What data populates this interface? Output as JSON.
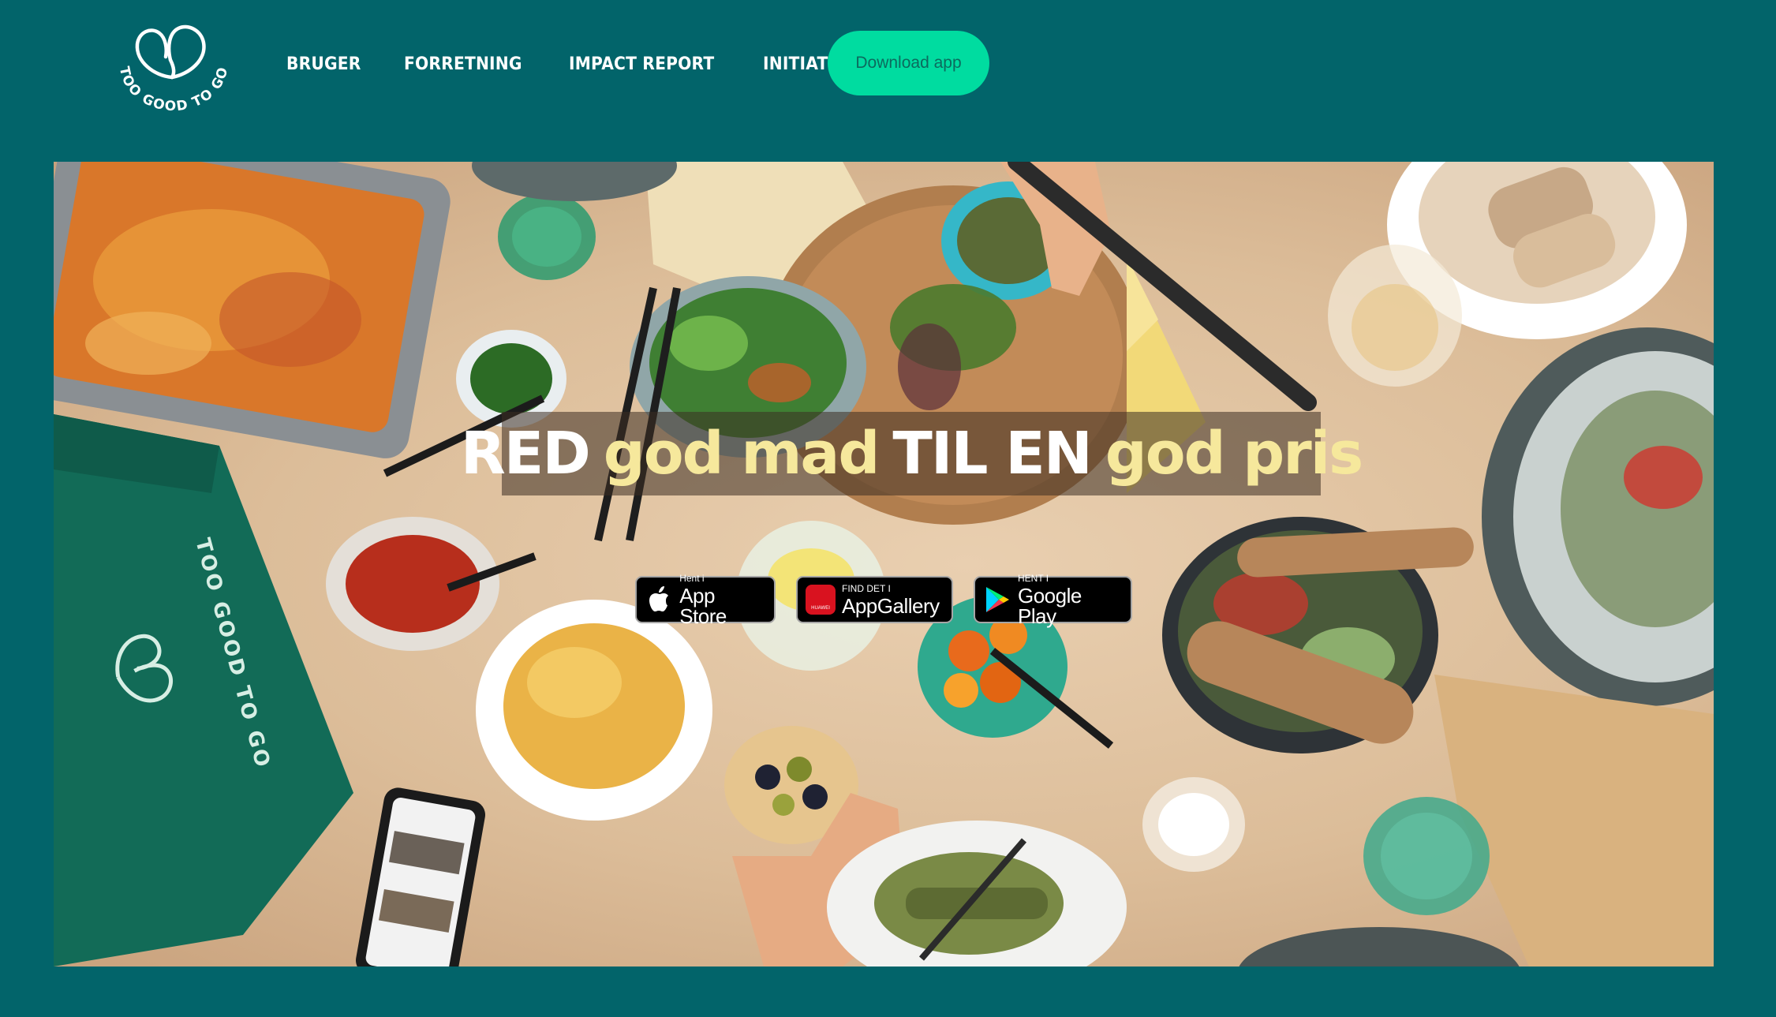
{
  "brand": {
    "logo_text": "TOO GOOD TO GO",
    "colors": {
      "background": "#02646a",
      "accent": "#00dca0",
      "highlight": "#f6e89c"
    }
  },
  "nav": {
    "items": [
      {
        "label": "BRUGER"
      },
      {
        "label": "FORRETNING"
      },
      {
        "label": "IMPACT REPORT"
      },
      {
        "label": "INITIATIVER"
      }
    ],
    "download_label": "Download app"
  },
  "hero": {
    "headline": {
      "part1": "RED",
      "part2": "god mad",
      "part3": "TIL EN",
      "part4": "god pris"
    },
    "bag_text": "TOO GOOD TO GO",
    "stores": {
      "apple": {
        "small": "Hent i",
        "big": "App Store",
        "icon": "apple-icon"
      },
      "huawei": {
        "small": "FIND DET I",
        "big": "AppGallery",
        "icon": "huawei-icon",
        "icon_text": "HUAWEI"
      },
      "google": {
        "small": "HENT I",
        "big": "Google Play",
        "icon": "google-play-icon"
      }
    }
  }
}
